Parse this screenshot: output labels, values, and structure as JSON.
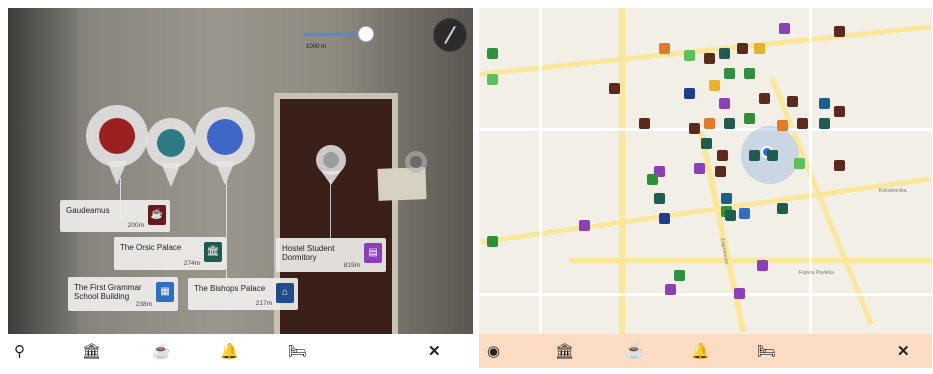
{
  "ar": {
    "slider_label": "1000 m",
    "cards": [
      {
        "name": "Gaudeamus",
        "dist": "200m",
        "color": "#6b1a1a",
        "icon": "cafe-icon",
        "glyph": "☕"
      },
      {
        "name": "The Orsic Palace",
        "dist": "274m",
        "color": "#1f5c4f",
        "icon": "museum-icon",
        "glyph": "🏛"
      },
      {
        "name": "Hostel Student Dormitory",
        "dist": "819m",
        "color": "#8b3fb8",
        "icon": "hostel-icon",
        "glyph": "▤"
      },
      {
        "name": "The First Grammar School Building",
        "dist": "238m",
        "color": "#2f6fc2",
        "icon": "school-icon",
        "glyph": "▦"
      },
      {
        "name": "The Bishops Palace",
        "dist": "217m",
        "color": "#1d4d8c",
        "icon": "palace-icon",
        "glyph": "⌂"
      }
    ],
    "toolbar": [
      "location-icon",
      "museum-icon",
      "cafe-icon",
      "food-icon",
      "bed-icon",
      "close-icon"
    ]
  },
  "map": {
    "labels": [
      "Kolodvorska",
      "Franca Pavleka",
      "Zagrebacka"
    ],
    "toolbar": [
      "eye-icon",
      "museum-icon",
      "cafe-icon",
      "food-icon",
      "bed-icon",
      "close-icon"
    ]
  }
}
